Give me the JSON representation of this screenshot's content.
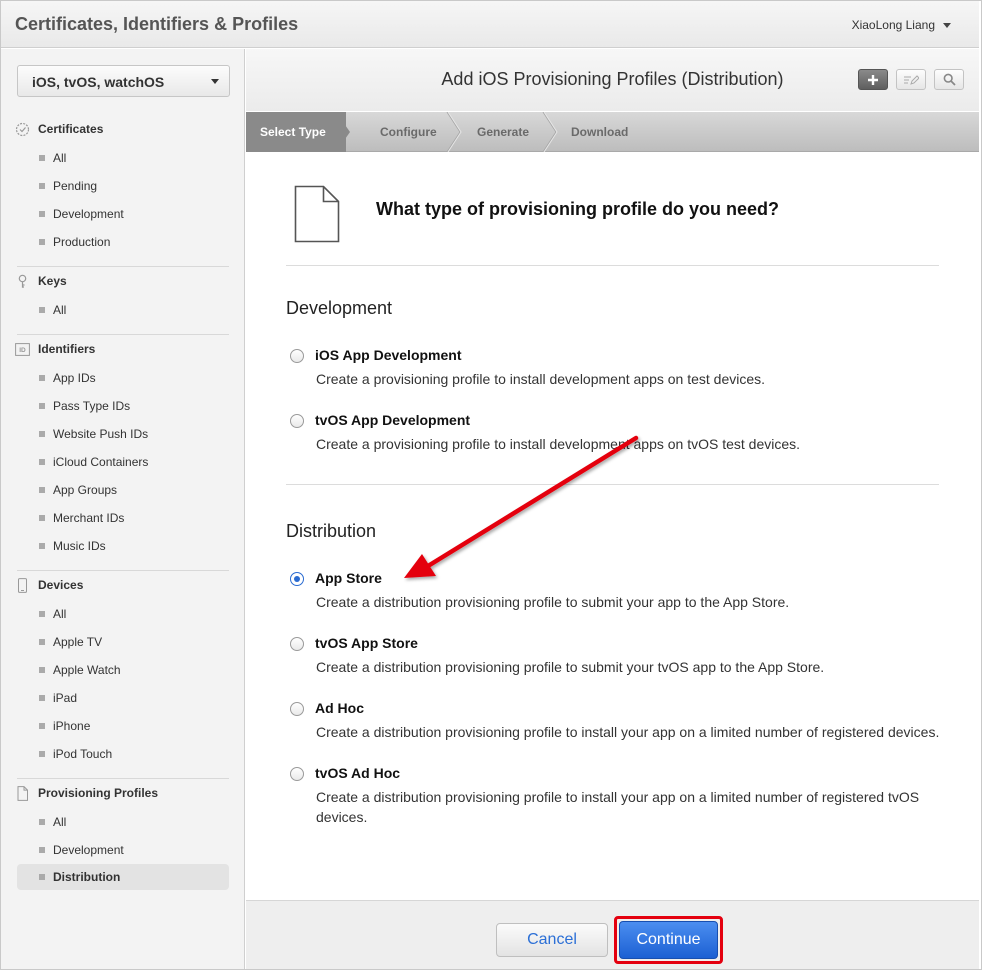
{
  "app": {
    "title": "Certificates, Identifiers & Profiles",
    "user": "XiaoLong Liang"
  },
  "sidebar": {
    "platform": "iOS, tvOS, watchOS",
    "sections": {
      "certificates": {
        "title": "Certificates",
        "items": [
          "All",
          "Pending",
          "Development",
          "Production"
        ]
      },
      "keys": {
        "title": "Keys",
        "items": [
          "All"
        ]
      },
      "identifiers": {
        "title": "Identifiers",
        "items": [
          "App IDs",
          "Pass Type IDs",
          "Website Push IDs",
          "iCloud Containers",
          "App Groups",
          "Merchant IDs",
          "Music IDs"
        ]
      },
      "devices": {
        "title": "Devices",
        "items": [
          "All",
          "Apple TV",
          "Apple Watch",
          "iPad",
          "iPhone",
          "iPod Touch"
        ]
      },
      "profiles": {
        "title": "Provisioning Profiles",
        "items": [
          "All",
          "Development",
          "Distribution"
        ],
        "active_item": "Distribution"
      }
    }
  },
  "main": {
    "title": "Add iOS Provisioning Profiles (Distribution)",
    "steps": [
      "Select Type",
      "Configure",
      "Generate",
      "Download"
    ],
    "active_step": "Select Type",
    "question": "What type of provisioning profile do you need?",
    "groups": {
      "development": {
        "title": "Development",
        "options": [
          {
            "label": "iOS App Development",
            "desc": "Create a provisioning profile to install development apps on test devices.",
            "checked": false
          },
          {
            "label": "tvOS App Development",
            "desc": "Create a provisioning profile to install development apps on tvOS test devices.",
            "checked": false
          }
        ]
      },
      "distribution": {
        "title": "Distribution",
        "options": [
          {
            "label": "App Store",
            "desc": "Create a distribution provisioning profile to submit your app to the App Store.",
            "checked": true
          },
          {
            "label": "tvOS App Store",
            "desc": "Create a distribution provisioning profile to submit your tvOS app to the App Store.",
            "checked": false
          },
          {
            "label": "Ad Hoc",
            "desc": "Create a distribution provisioning profile to install your app on a limited number of registered devices.",
            "checked": false
          },
          {
            "label": "tvOS Ad Hoc",
            "desc": "Create a distribution provisioning profile to install your app on a limited number of registered tvOS devices.",
            "checked": false
          }
        ]
      }
    }
  },
  "footer": {
    "cancel_label": "Cancel",
    "continue_label": "Continue"
  },
  "colors": {
    "accent": "#1c60d3",
    "annotation": "#e4000f"
  }
}
